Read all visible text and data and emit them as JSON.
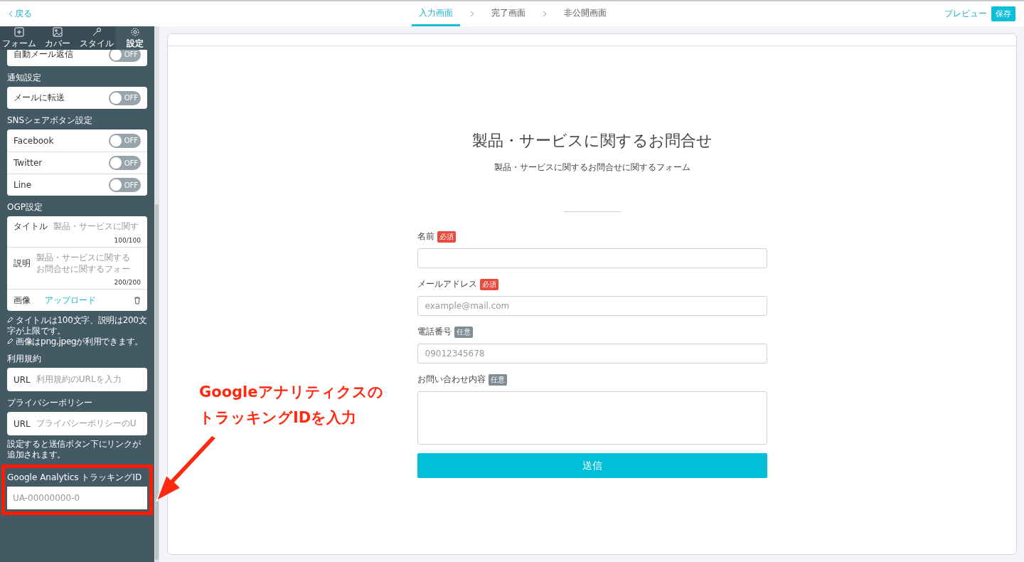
{
  "topbar": {
    "back": "戻る",
    "steps": [
      {
        "label": "入力画面",
        "selected": true
      },
      {
        "label": "完了画面",
        "selected": false
      },
      {
        "label": "非公開画面",
        "selected": false
      }
    ],
    "preview": "プレビュー",
    "save": "保存"
  },
  "sidebar": {
    "tabs": [
      {
        "label": "フォーム",
        "selected": false
      },
      {
        "label": "カバー",
        "selected": false
      },
      {
        "label": "スタイル",
        "selected": false
      },
      {
        "label": "設定",
        "selected": true
      }
    ],
    "partial_row": {
      "label": "自動メール返信",
      "on": false,
      "text": "OFF"
    },
    "sections": [
      {
        "kind": "toggles",
        "title": "通知設定",
        "rows": [
          {
            "label": "メールに転送",
            "on": false,
            "text": "OFF"
          }
        ]
      },
      {
        "kind": "toggles",
        "title": "SNSシェアボタン設定",
        "rows": [
          {
            "label": "Facebook",
            "on": false,
            "text": "OFF"
          },
          {
            "label": "Twitter",
            "on": false,
            "text": "OFF"
          },
          {
            "label": "Line",
            "on": false,
            "text": "OFF"
          }
        ]
      },
      {
        "kind": "ogp",
        "title": "OGP設定",
        "title_label": "タイトル",
        "title_value": "製品・サービスに関す",
        "title_count": "100/100",
        "desc_label": "説明",
        "desc_value": "製品・サービスに関するお問合せに関するフォー",
        "desc_count": "200/200",
        "image_label": "画像",
        "upload": "アップロード",
        "notes": [
          "タイトルは100文字、説明は200文字が上限です。",
          "画像はpng,jpegが利用できます。"
        ]
      },
      {
        "kind": "url",
        "title": "利用規約",
        "label": "URL",
        "placeholder": "利用規約のURLを入力"
      },
      {
        "kind": "url",
        "title": "プライバシーポリシー",
        "label": "URL",
        "placeholder": "プライバシーポリシーのU",
        "note": "設定すると送信ボタン下にリンクが追加されます。"
      },
      {
        "kind": "ga",
        "title": "Google Analytics トラッキングID",
        "placeholder": "UA-00000000-0",
        "highlighted": true
      }
    ]
  },
  "form": {
    "title": "製品・サービスに関するお問合せ",
    "subtitle": "製品・サービスに関するお問合せに関するフォーム",
    "fields": [
      {
        "label": "名前",
        "badge": "必須",
        "required": true,
        "kind": "input"
      },
      {
        "label": "メールアドレス",
        "badge": "必須",
        "required": true,
        "kind": "input",
        "placeholder": "example@mail.com"
      },
      {
        "label": "電話番号",
        "badge": "任意",
        "required": false,
        "kind": "input",
        "placeholder": "09012345678"
      },
      {
        "label": "お問い合わせ内容",
        "badge": "任意",
        "required": false,
        "kind": "textarea"
      }
    ],
    "submit": "送信"
  },
  "annotation": {
    "lines": [
      "Googleアナリティクスの",
      "トラッキングIDを入力"
    ]
  }
}
